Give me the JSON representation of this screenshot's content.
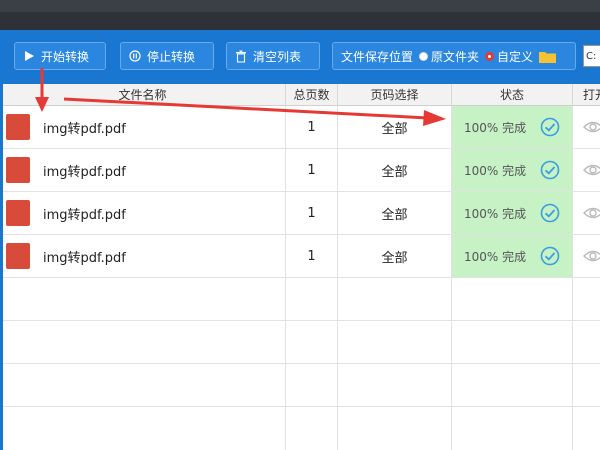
{
  "toolbar": {
    "start_label": "开始转换",
    "stop_label": "停止转换",
    "clear_label": "清空列表",
    "save_location_label": "文件保存位置",
    "option_original": "原文件夹",
    "option_custom": "自定义",
    "selected_option": "自定义",
    "path_value": "C:"
  },
  "table": {
    "headers": [
      "文件名称",
      "总页数",
      "页码选择",
      "状态",
      "打开"
    ],
    "rows": [
      {
        "name": "img转pdf.pdf",
        "pages": "1",
        "range": "全部",
        "status": "100% 完成"
      },
      {
        "name": "img转pdf.pdf",
        "pages": "1",
        "range": "全部",
        "status": "100% 完成"
      },
      {
        "name": "img转pdf.pdf",
        "pages": "1",
        "range": "全部",
        "status": "100% 完成"
      },
      {
        "name": "img转pdf.pdf",
        "pages": "1",
        "range": "全部",
        "status": "100% 完成"
      }
    ]
  },
  "colors": {
    "toolbar_bg": "#1977d2",
    "status_bg": "#c6f2c6",
    "annotation_arrow": "#e53935"
  }
}
